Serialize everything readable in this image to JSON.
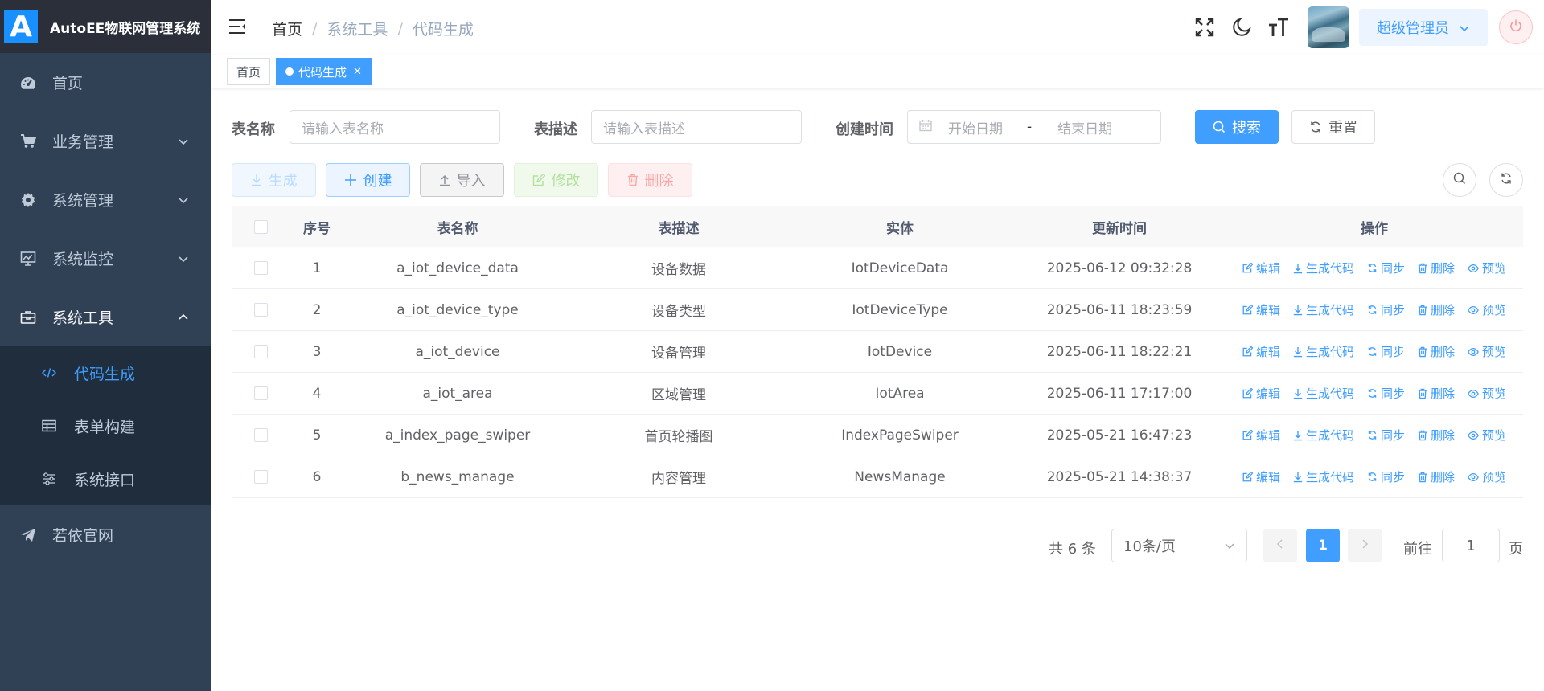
{
  "app": {
    "logo_letter": "A",
    "title": "AutoEE物联网管理系统"
  },
  "sidebar": {
    "items": [
      {
        "label": "首页",
        "icon": "dashboard-icon"
      },
      {
        "label": "业务管理",
        "icon": "shopping-cart-icon"
      },
      {
        "label": "系统管理",
        "icon": "gear-icon"
      },
      {
        "label": "系统监控",
        "icon": "monitor-icon"
      },
      {
        "label": "系统工具",
        "icon": "toolbox-icon"
      },
      {
        "label": "若依官网",
        "icon": "paper-plane-icon"
      }
    ],
    "tools_sub": [
      {
        "label": "代码生成",
        "icon": "code-icon"
      },
      {
        "label": "表单构建",
        "icon": "table-icon"
      },
      {
        "label": "系统接口",
        "icon": "sliders-icon"
      }
    ]
  },
  "header": {
    "breadcrumb": [
      "首页",
      "系统工具",
      "代码生成"
    ],
    "user_name": "超级管理员"
  },
  "tags": {
    "home": "首页",
    "current": "代码生成"
  },
  "search": {
    "table_name_label": "表名称",
    "table_name_placeholder": "请输入表名称",
    "table_desc_label": "表描述",
    "table_desc_placeholder": "请输入表描述",
    "create_time_label": "创建时间",
    "start_placeholder": "开始日期",
    "range_separator": "-",
    "end_placeholder": "结束日期",
    "search_btn": "搜索",
    "reset_btn": "重置"
  },
  "toolbar": {
    "generate": "生成",
    "create": "创建",
    "import": "导入",
    "edit": "修改",
    "delete": "删除"
  },
  "table": {
    "headers": [
      "序号",
      "表名称",
      "表描述",
      "实体",
      "更新时间",
      "操作"
    ],
    "ops": [
      "编辑",
      "生成代码",
      "同步",
      "删除",
      "预览"
    ],
    "rows": [
      {
        "no": "1",
        "name": "a_iot_device_data",
        "desc": "设备数据",
        "entity": "IotDeviceData",
        "time": "2025-06-12 09:32:28"
      },
      {
        "no": "2",
        "name": "a_iot_device_type",
        "desc": "设备类型",
        "entity": "IotDeviceType",
        "time": "2025-06-11 18:23:59"
      },
      {
        "no": "3",
        "name": "a_iot_device",
        "desc": "设备管理",
        "entity": "IotDevice",
        "time": "2025-06-11 18:22:21"
      },
      {
        "no": "4",
        "name": "a_iot_area",
        "desc": "区域管理",
        "entity": "IotArea",
        "time": "2025-06-11 17:17:00"
      },
      {
        "no": "5",
        "name": "a_index_page_swiper",
        "desc": "首页轮播图",
        "entity": "IndexPageSwiper",
        "time": "2025-05-21 16:47:23"
      },
      {
        "no": "6",
        "name": "b_news_manage",
        "desc": "内容管理",
        "entity": "NewsManage",
        "time": "2025-05-21 14:38:37"
      }
    ]
  },
  "pagination": {
    "total": "共 6 条",
    "page_size": "10条/页",
    "current": "1",
    "goto_label": "前往",
    "goto_value": "1",
    "page_suffix": "页"
  },
  "colors": {
    "primary": "#409eff",
    "sidebar_bg": "#304156",
    "submenu_bg": "#1f2d3d"
  }
}
